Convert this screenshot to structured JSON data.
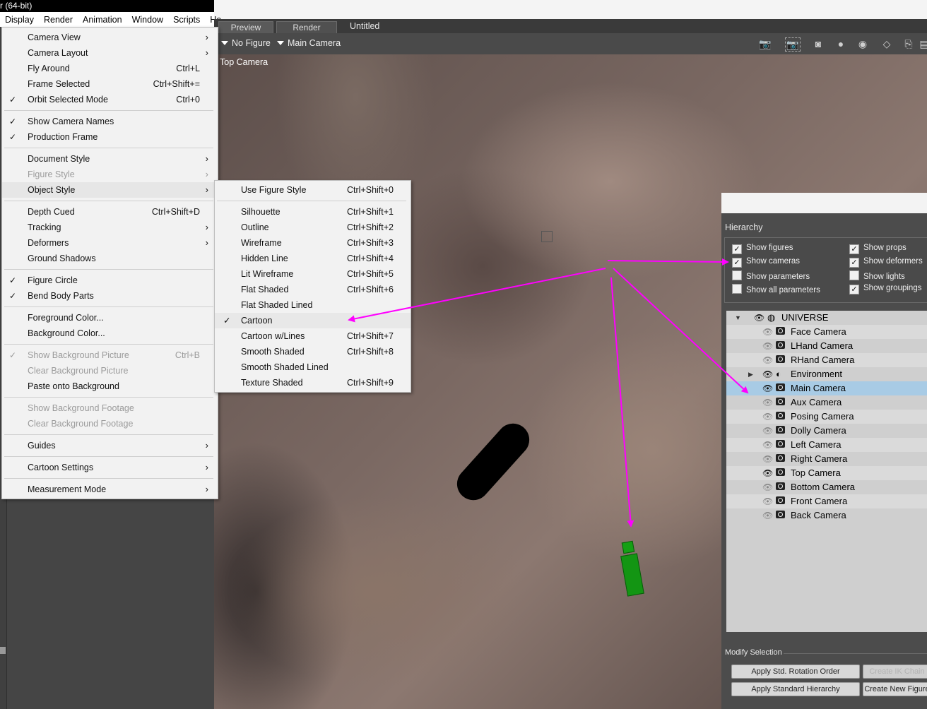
{
  "app": {
    "title_fragment": "r (64-bit)"
  },
  "menubar": [
    {
      "label": "Display"
    },
    {
      "label": "Render"
    },
    {
      "label": "Animation"
    },
    {
      "label": "Window"
    },
    {
      "label": "Scripts"
    },
    {
      "label": "He"
    }
  ],
  "tabs": {
    "preview": "Preview",
    "render": "Render",
    "document": "Untitled"
  },
  "toolbar": {
    "figure_dropdown": "No Figure",
    "camera_dropdown": "Main Camera"
  },
  "viewport": {
    "camera_label": "Top Camera"
  },
  "display_menu": [
    {
      "label": "Camera View",
      "shortcut": "",
      "submenu": true,
      "checked": false,
      "disabled": false
    },
    {
      "label": "Camera Layout",
      "shortcut": "",
      "submenu": true,
      "checked": false,
      "disabled": false
    },
    {
      "label": "Fly Around",
      "shortcut": "Ctrl+L",
      "submenu": false,
      "checked": false,
      "disabled": false
    },
    {
      "label": "Frame Selected",
      "shortcut": "Ctrl+Shift+=",
      "submenu": false,
      "checked": false,
      "disabled": false
    },
    {
      "label": "Orbit Selected Mode",
      "shortcut": "Ctrl+0",
      "submenu": false,
      "checked": true,
      "disabled": false
    },
    {
      "label": "Show Camera Names",
      "shortcut": "",
      "submenu": false,
      "checked": true,
      "disabled": false
    },
    {
      "label": "Production Frame",
      "shortcut": "",
      "submenu": false,
      "checked": true,
      "disabled": false
    },
    {
      "label": "Document Style",
      "shortcut": "",
      "submenu": true,
      "checked": false,
      "disabled": false
    },
    {
      "label": "Figure Style",
      "shortcut": "",
      "submenu": true,
      "checked": false,
      "disabled": true
    },
    {
      "label": "Object Style",
      "shortcut": "",
      "submenu": true,
      "checked": false,
      "disabled": false
    },
    {
      "label": "Depth Cued",
      "shortcut": "Ctrl+Shift+D",
      "submenu": false,
      "checked": false,
      "disabled": false
    },
    {
      "label": "Tracking",
      "shortcut": "",
      "submenu": true,
      "checked": false,
      "disabled": false
    },
    {
      "label": "Deformers",
      "shortcut": "",
      "submenu": true,
      "checked": false,
      "disabled": false
    },
    {
      "label": "Ground Shadows",
      "shortcut": "",
      "submenu": false,
      "checked": false,
      "disabled": false
    },
    {
      "label": "Figure Circle",
      "shortcut": "",
      "submenu": false,
      "checked": true,
      "disabled": false
    },
    {
      "label": "Bend Body Parts",
      "shortcut": "",
      "submenu": false,
      "checked": true,
      "disabled": false
    },
    {
      "label": "Foreground Color...",
      "shortcut": "",
      "submenu": false,
      "checked": false,
      "disabled": false
    },
    {
      "label": "Background Color...",
      "shortcut": "",
      "submenu": false,
      "checked": false,
      "disabled": false
    },
    {
      "label": "Show Background Picture",
      "shortcut": "Ctrl+B",
      "submenu": false,
      "checked": true,
      "disabled": true
    },
    {
      "label": "Clear Background Picture",
      "shortcut": "",
      "submenu": false,
      "checked": false,
      "disabled": true
    },
    {
      "label": "Paste onto Background",
      "shortcut": "",
      "submenu": false,
      "checked": false,
      "disabled": false
    },
    {
      "label": "Show Background Footage",
      "shortcut": "",
      "submenu": false,
      "checked": false,
      "disabled": true
    },
    {
      "label": "Clear Background Footage",
      "shortcut": "",
      "submenu": false,
      "checked": false,
      "disabled": true
    },
    {
      "label": "Guides",
      "shortcut": "",
      "submenu": true,
      "checked": false,
      "disabled": false
    },
    {
      "label": "Cartoon Settings",
      "shortcut": "",
      "submenu": true,
      "checked": false,
      "disabled": false
    },
    {
      "label": "Measurement Mode",
      "shortcut": "",
      "submenu": true,
      "checked": false,
      "disabled": false
    }
  ],
  "object_style_menu": [
    {
      "label": "Use Figure Style",
      "shortcut": "Ctrl+Shift+0",
      "checked": false
    },
    {
      "label": "Silhouette",
      "shortcut": "Ctrl+Shift+1",
      "checked": false
    },
    {
      "label": "Outline",
      "shortcut": "Ctrl+Shift+2",
      "checked": false
    },
    {
      "label": "Wireframe",
      "shortcut": "Ctrl+Shift+3",
      "checked": false
    },
    {
      "label": "Hidden Line",
      "shortcut": "Ctrl+Shift+4",
      "checked": false
    },
    {
      "label": "Lit Wireframe",
      "shortcut": "Ctrl+Shift+5",
      "checked": false
    },
    {
      "label": "Flat Shaded",
      "shortcut": "Ctrl+Shift+6",
      "checked": false
    },
    {
      "label": "Flat Shaded Lined",
      "shortcut": "",
      "checked": false
    },
    {
      "label": "Cartoon",
      "shortcut": "",
      "checked": true
    },
    {
      "label": "Cartoon w/Lines",
      "shortcut": "Ctrl+Shift+7",
      "checked": false
    },
    {
      "label": "Smooth Shaded",
      "shortcut": "Ctrl+Shift+8",
      "checked": false
    },
    {
      "label": "Smooth Shaded Lined",
      "shortcut": "",
      "checked": false
    },
    {
      "label": "Texture Shaded",
      "shortcut": "Ctrl+Shift+9",
      "checked": false
    }
  ],
  "hierarchy": {
    "title": "Hierarchy",
    "options": [
      {
        "label": "Show figures",
        "checked": true
      },
      {
        "label": "Show props",
        "checked": true
      },
      {
        "label": "Show cameras",
        "checked": true
      },
      {
        "label": "Show deformers",
        "checked": true
      },
      {
        "label": "Show parameters",
        "checked": false
      },
      {
        "label": "Show lights",
        "checked": false
      },
      {
        "label": "Show all parameters",
        "checked": false
      },
      {
        "label": "Show groupings",
        "checked": true
      }
    ],
    "tree": [
      {
        "label": "UNIVERSE",
        "icon": "globe-icon",
        "selected": false
      },
      {
        "label": "Face Camera",
        "icon": "camera-icon",
        "selected": false
      },
      {
        "label": "LHand Camera",
        "icon": "camera-icon",
        "selected": false
      },
      {
        "label": "RHand Camera",
        "icon": "camera-icon",
        "selected": false
      },
      {
        "label": "Environment",
        "icon": "environment-icon",
        "selected": false
      },
      {
        "label": "Main Camera",
        "icon": "camera-icon",
        "selected": true
      },
      {
        "label": "Aux Camera",
        "icon": "camera-icon",
        "selected": false
      },
      {
        "label": "Posing Camera",
        "icon": "camera-icon",
        "selected": false
      },
      {
        "label": "Dolly Camera",
        "icon": "camera-icon",
        "selected": false
      },
      {
        "label": "Left Camera",
        "icon": "camera-icon",
        "selected": false
      },
      {
        "label": "Right Camera",
        "icon": "camera-icon",
        "selected": false
      },
      {
        "label": "Top Camera",
        "icon": "camera-icon",
        "selected": false
      },
      {
        "label": "Bottom Camera",
        "icon": "camera-icon",
        "selected": false
      },
      {
        "label": "Front Camera",
        "icon": "camera-icon",
        "selected": false
      },
      {
        "label": "Back Camera",
        "icon": "camera-icon",
        "selected": false
      }
    ],
    "modify_selection": "Modify Selection",
    "buttons": [
      {
        "label": "Apply Std. Rotation Order",
        "disabled": false
      },
      {
        "label": "Create IK Chain",
        "disabled": true
      },
      {
        "label": "Apply Standard Hierarchy",
        "disabled": false
      },
      {
        "label": "Create New Figure",
        "disabled": false
      }
    ]
  },
  "colors": {
    "annotation_arrow": "#ff00ff",
    "selection": "#a8cbe5",
    "camera_prop": "#139513"
  }
}
